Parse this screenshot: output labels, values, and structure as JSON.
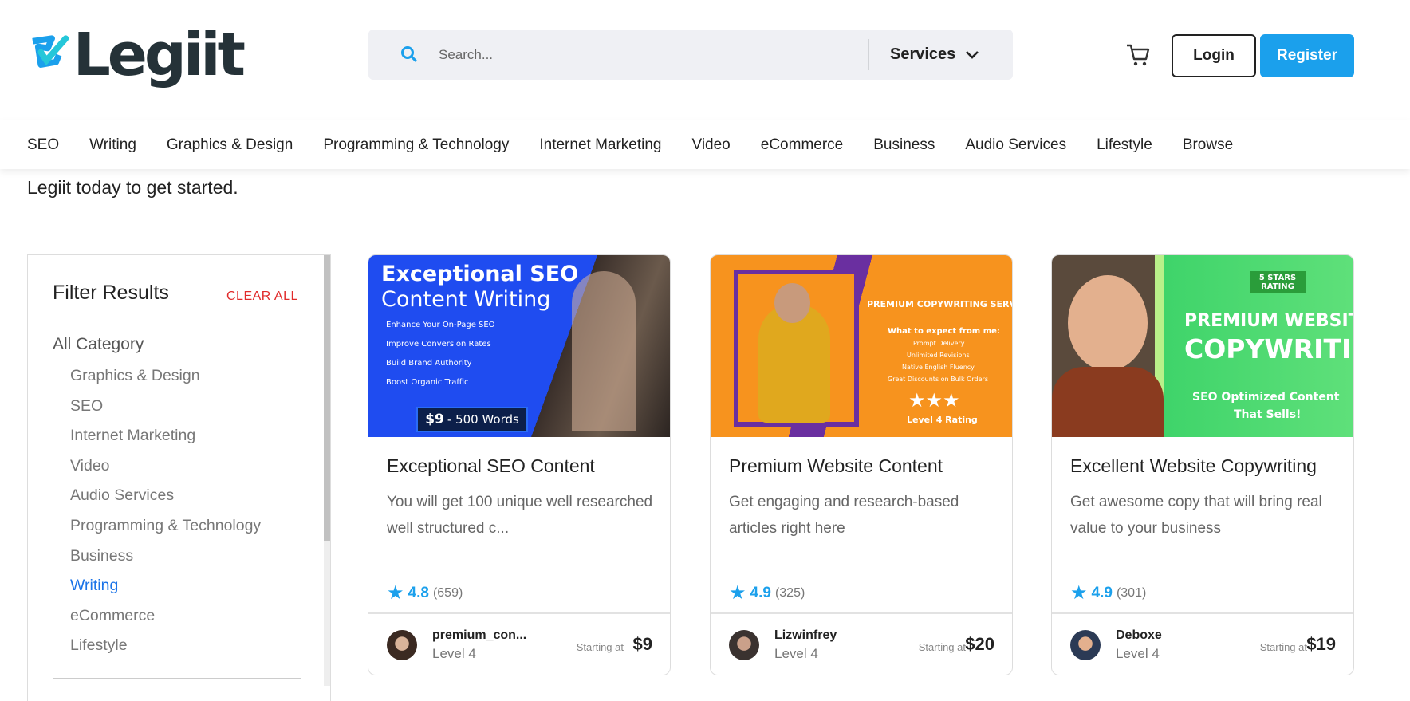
{
  "brand": {
    "name": "Legiit",
    "colors": {
      "accent": "#1ba0ec",
      "logo_dark": "#253238",
      "clear": "#e12b2b",
      "active": "#1a73e8"
    }
  },
  "header": {
    "search_placeholder": "Search...",
    "search_icon": "search-icon",
    "category_select": "Services",
    "cart_icon": "cart-icon",
    "login": "Login",
    "register": "Register"
  },
  "nav": [
    "SEO",
    "Writing",
    "Graphics & Design",
    "Programming & Technology",
    "Internet Marketing",
    "Video",
    "eCommerce",
    "Business",
    "Audio Services",
    "Lifestyle",
    "Browse"
  ],
  "intro": "Legiit today to get started.",
  "filter": {
    "title": "Filter Results",
    "clear": "CLEAR ALL",
    "all_category": "All Category",
    "categories": [
      "Graphics & Design",
      "SEO",
      "Internet Marketing",
      "Video",
      "Audio Services",
      "Programming & Technology",
      "Business",
      "Writing",
      "eCommerce",
      "Lifestyle"
    ],
    "active": "Writing"
  },
  "cards": [
    {
      "title": "Exceptional SEO Content",
      "desc": "You will get 100 unique well researched well structured c...",
      "rating": "4.8",
      "reviews": "(659)",
      "seller": "premium_con...",
      "level": "Level 4",
      "starting": "Starting at",
      "price": "$9",
      "banner": {
        "h1": "Exceptional SEO",
        "h2": "Content Writing",
        "bullets": [
          "Enhance Your On-Page SEO",
          "Improve Conversion Rates",
          "Build Brand Authority",
          "Boost Organic Traffic"
        ],
        "badge_price": "$9",
        "badge_text": "- 500 Words"
      }
    },
    {
      "title": "Premium Website Content",
      "desc": "Get engaging and research-based articles right here",
      "rating": "4.9",
      "reviews": "(325)",
      "seller": "Lizwinfrey",
      "level": "Level 4",
      "starting": "Starting at",
      "price": "$20",
      "banner": {
        "h1": "PREMIUM COPYWRITING SERVICE",
        "h2": "What to expect from me:",
        "bullets": [
          "Prompt Delivery",
          "Unlimited Revisions",
          "Native English Fluency",
          "Great Discounts on Bulk Orders"
        ],
        "foot": "Level 4 Rating"
      }
    },
    {
      "title": "Excellent Website Copywriting",
      "desc": "Get awesome copy that will bring real value to your business",
      "rating": "4.9",
      "reviews": "(301)",
      "seller": "Deboxe",
      "level": "Level 4",
      "starting": "Starting at",
      "price": "$19",
      "banner": {
        "badge": "5 STARS RATING",
        "h1": "PREMIUM WEBSITE",
        "h2": "COPYWRITING",
        "sub1": "SEO Optimized Content",
        "sub2": "That Sells!"
      }
    }
  ]
}
